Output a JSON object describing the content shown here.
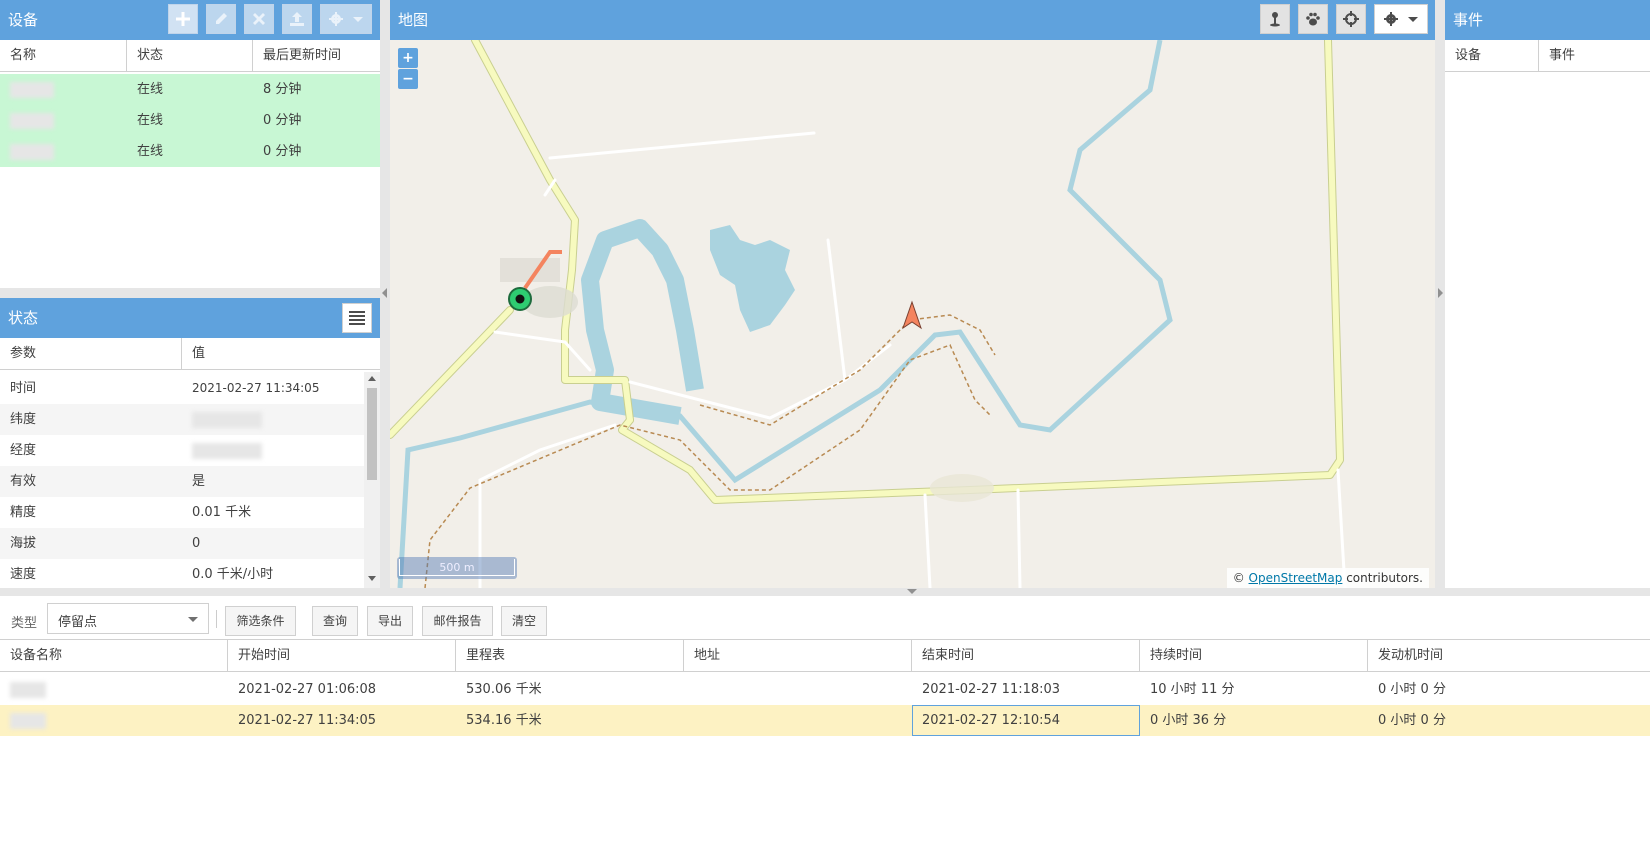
{
  "devices_panel": {
    "title": "设备",
    "columns": [
      "名称",
      "状态",
      "最后更新时间"
    ],
    "rows": [
      {
        "status": "在线",
        "last_update": "8 分钟"
      },
      {
        "status": "在线",
        "last_update": "0 分钟"
      },
      {
        "status": "在线",
        "last_update": "0 分钟"
      }
    ]
  },
  "state_panel": {
    "title": "状态",
    "columns": [
      "参数",
      "值"
    ],
    "rows": [
      {
        "param": "时间",
        "value": "2021-02-27 11:34:05"
      },
      {
        "param": "纬度",
        "value": ""
      },
      {
        "param": "经度",
        "value": ""
      },
      {
        "param": "有效",
        "value": "是"
      },
      {
        "param": "精度",
        "value": "0.01 千米"
      },
      {
        "param": "海拔",
        "value": "0"
      },
      {
        "param": "速度",
        "value": "0.0 千米/小时"
      }
    ]
  },
  "map_panel": {
    "title": "地图",
    "zoom_in": "+",
    "zoom_out": "−",
    "scale": "500 m",
    "attribution_prefix": "©",
    "attribution_link": "OpenStreetMap",
    "attribution_suffix": "contributors."
  },
  "events_panel": {
    "title": "事件",
    "columns": [
      "设备",
      "事件"
    ]
  },
  "report": {
    "type_label": "类型",
    "type_value": "停留点",
    "buttons": [
      "筛选条件",
      "查询",
      "导出",
      "邮件报告",
      "清空"
    ],
    "columns": [
      "设备名称",
      "开始时间",
      "里程表",
      "地址",
      "结束时间",
      "持续时间",
      "发动机时间"
    ],
    "rows": [
      {
        "start": "2021-02-27 01:06:08",
        "odometer": "530.06 千米",
        "address": "",
        "end": "2021-02-27 11:18:03",
        "duration": "10 小时 11 分",
        "engine": "0 小时 0 分"
      },
      {
        "start": "2021-02-27 11:34:05",
        "odometer": "534.16 千米",
        "address": "",
        "end": "2021-02-27 12:10:54",
        "duration": "0 小时 36 分",
        "engine": "0 小时 0 分"
      }
    ]
  },
  "colors": {
    "header": "#5fa2dd",
    "online_row": "#c8f7d4",
    "selected_row": "#fdf2c3",
    "map_bg": "#f2efe9",
    "water": "#aad3df",
    "road": "#f7fabf"
  }
}
